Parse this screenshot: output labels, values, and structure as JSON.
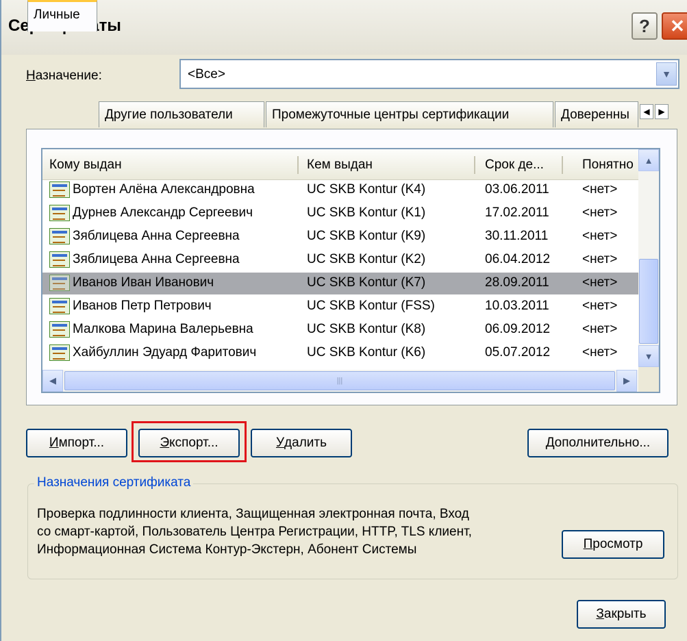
{
  "window": {
    "title": "Сертификаты",
    "help_label": "?",
    "close_label": "✕"
  },
  "purpose": {
    "label": "Назначение:",
    "label_access_key": "Н",
    "label_rest": "азначение:",
    "value": "<Все>"
  },
  "tabs": [
    {
      "label": "Личные",
      "active": true
    },
    {
      "label": "Другие пользователи",
      "active": false
    },
    {
      "label": "Промежуточные центры сертификации",
      "active": false
    },
    {
      "label": "Доверенны",
      "active": false
    }
  ],
  "tab_scroll": {
    "left": "◀",
    "right": "▶"
  },
  "table": {
    "columns": [
      "Кому выдан",
      "Кем выдан",
      "Срок де...",
      "Понятно"
    ],
    "rows": [
      {
        "issued_to": "Вортен Алёна Александровна",
        "issued_by": "UC SKB Kontur (K4)",
        "expires": "03.06.2011",
        "friendly": "<нет>",
        "selected": false
      },
      {
        "issued_to": "Дурнев Александр Сергеевич",
        "issued_by": "UC SKB Kontur (K1)",
        "expires": "17.02.2011",
        "friendly": "<нет>",
        "selected": false
      },
      {
        "issued_to": "Зяблицева Анна Сергеевна",
        "issued_by": "UC SKB Kontur (K9)",
        "expires": "30.11.2011",
        "friendly": "<нет>",
        "selected": false
      },
      {
        "issued_to": "Зяблицева Анна Сергеевна",
        "issued_by": "UC SKB Kontur (K2)",
        "expires": "06.04.2012",
        "friendly": "<нет>",
        "selected": false
      },
      {
        "issued_to": "Иванов Иван Иванович",
        "issued_by": "UC SKB Kontur (K7)",
        "expires": "28.09.2011",
        "friendly": "<нет>",
        "selected": true
      },
      {
        "issued_to": "Иванов Петр Петрович",
        "issued_by": "UC SKB Kontur (FSS)",
        "expires": "10.03.2011",
        "friendly": "<нет>",
        "selected": false
      },
      {
        "issued_to": "Малкова Марина Валерьевна",
        "issued_by": "UC SKB Kontur (K8)",
        "expires": "06.09.2012",
        "friendly": "<нет>",
        "selected": false
      },
      {
        "issued_to": "Хайбуллин Эдуард Фаритович",
        "issued_by": "UC SKB Kontur (K6)",
        "expires": "05.07.2012",
        "friendly": "<нет>",
        "selected": false
      }
    ]
  },
  "scrollbars": {
    "up": "▲",
    "down": "▼",
    "left": "◀",
    "right": "▶",
    "grip": "|||"
  },
  "buttons": {
    "import": {
      "key": "И",
      "rest": "мпорт..."
    },
    "export": {
      "key": "Э",
      "rest": "кспорт..."
    },
    "delete": {
      "key": "У",
      "rest": "далить"
    },
    "advanced": {
      "key": "Д",
      "rest": "ополнительно..."
    },
    "view": {
      "key": "П",
      "rest": "росмотр"
    },
    "close": {
      "key": "З",
      "rest": "акрыть"
    }
  },
  "cert_purposes": {
    "title": "Назначения сертификата",
    "lines": [
      "Проверка подлинности клиента, Защищенная электронная почта, Вход",
      "со смарт-картой, Пользователь Центра Регистрации, HTTP, TLS клиент,",
      "Информационная Система Контур-Экстерн, Абонент Системы"
    ]
  },
  "colors": {
    "accent_highlight": "#e0141a",
    "selection": "#a7a9ae",
    "group_title": "#0046d5",
    "dialog_bg": "#ece9d8"
  }
}
